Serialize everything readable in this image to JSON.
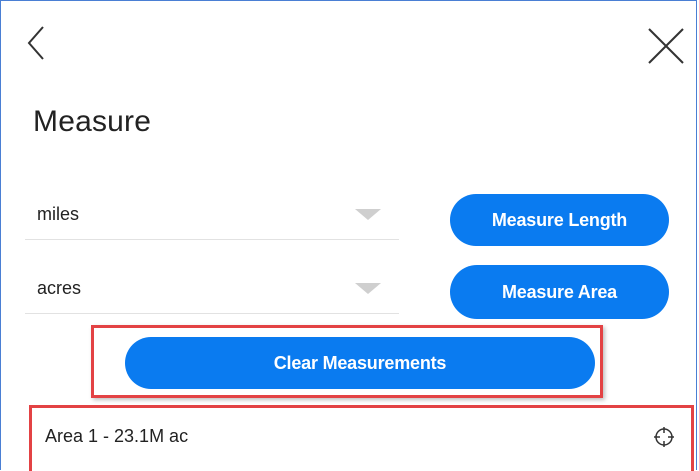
{
  "header": {
    "title": "Measure",
    "back_icon": "chevron-left-icon",
    "close_icon": "close-icon"
  },
  "length": {
    "unit_value": "miles",
    "button_label": "Measure Length"
  },
  "area": {
    "unit_value": "acres",
    "button_label": "Measure Area"
  },
  "clear": {
    "button_label": "Clear Measurements"
  },
  "results": [
    {
      "label": "Area 1 - 23.1M ac",
      "icon": "crosshair-icon"
    }
  ],
  "colors": {
    "accent": "#0a7bf0",
    "highlight": "#e34244",
    "border": "#4a7fd4"
  }
}
